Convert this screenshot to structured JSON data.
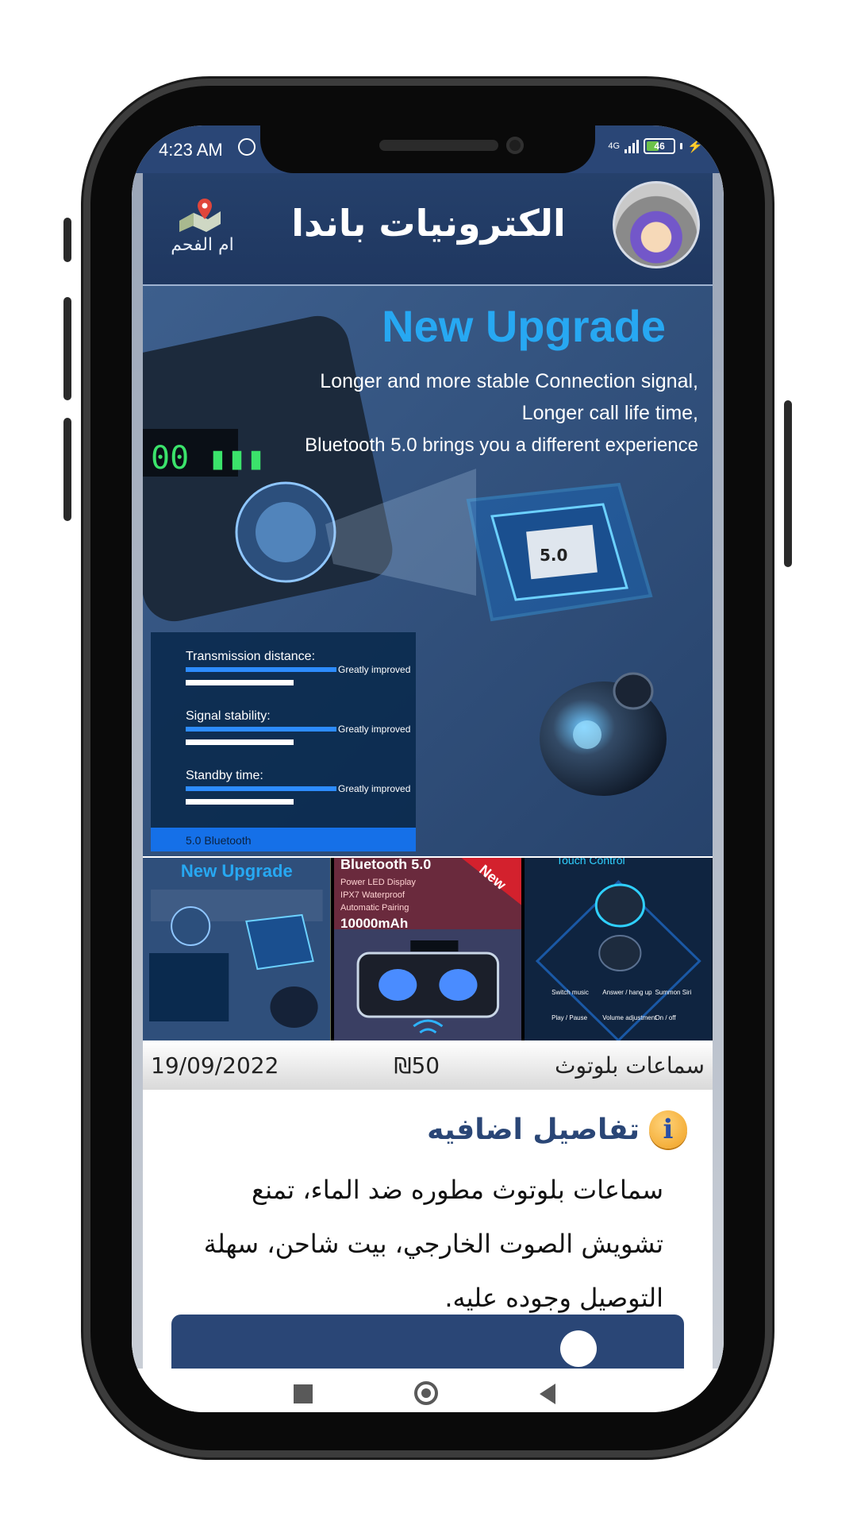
{
  "status_bar": {
    "time": "4:23 AM",
    "network": "4G",
    "battery": "46",
    "battery_level": 0.46
  },
  "header": {
    "store_name": "الكترونيات باندا",
    "location_label": "ام الفحم",
    "avatar_icon": "panda-avatar-icon",
    "location_icon": "map-pin-icon"
  },
  "main_image": {
    "title": "New Upgrade",
    "lines": [
      "Longer and more stable Connection signal,",
      "Longer call life time,",
      "Bluetooth 5.0 brings you a different experience"
    ],
    "chip_label": "5.0",
    "features": [
      {
        "label": "Transmission distance:",
        "note": "Greatly improved"
      },
      {
        "label": "Signal stability:",
        "note": "Greatly improved"
      },
      {
        "label": "Standby time:",
        "note": "Greatly improved"
      }
    ],
    "panel_footer": "5.0 Bluetooth"
  },
  "thumbnails": [
    {
      "caption": "New Upgrade",
      "selected": true
    },
    {
      "caption": "Bluetooth 5.0",
      "lines": [
        "Power LED Display",
        "IPX7 Waterproof",
        "Automatic Pairing",
        "10000mAh"
      ],
      "badge": "New",
      "selected": false
    },
    {
      "caption": "Touch Control",
      "lines": [
        "Switch music",
        "Answer / hang up",
        "Summon Siri",
        "Play / Pause",
        "Volume adjustment",
        "On / off"
      ],
      "selected": false
    }
  ],
  "product": {
    "title": "سماعات بلوتوث",
    "price": "₪50",
    "date": "19/09/2022"
  },
  "details": {
    "heading": "تفاصيل اضافيه",
    "text": "سماعات بلوتوث مطوره ضد الماء، تمنع تشويش الصوت الخارجي، بيت شاحن، سهلة التوصيل وجوده عليه."
  },
  "colors": {
    "brand": "#2a4676",
    "accent": "#f1c40f"
  }
}
